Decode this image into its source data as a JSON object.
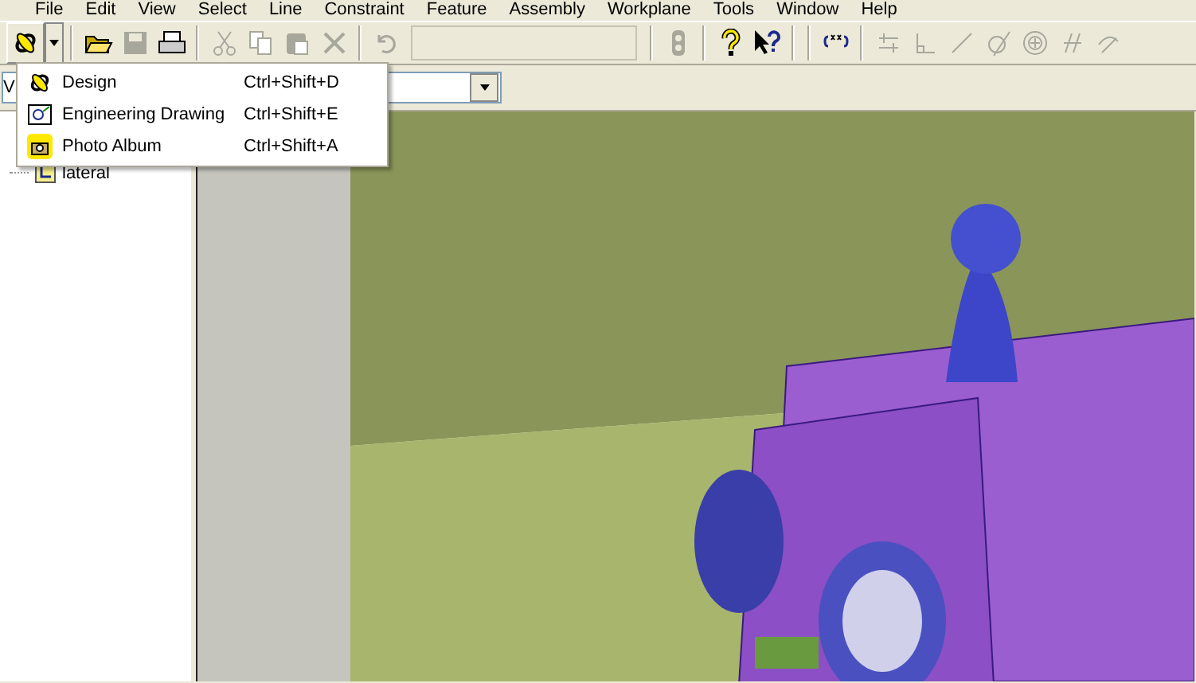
{
  "menu_bar": [
    "File",
    "Edit",
    "View",
    "Select",
    "Line",
    "Constraint",
    "Feature",
    "Assembly",
    "Workplane",
    "Tools",
    "Window",
    "Help"
  ],
  "toolbar": [
    {
      "kind": "split",
      "disabled": false
    },
    {
      "kind": "separator"
    },
    {
      "kind": "button",
      "disabled": false
    },
    {
      "kind": "button",
      "disabled": true
    },
    {
      "kind": "button",
      "disabled": false
    },
    {
      "kind": "separator"
    },
    {
      "kind": "button",
      "disabled": true
    },
    {
      "kind": "button",
      "disabled": true
    },
    {
      "kind": "button",
      "disabled": true
    },
    {
      "kind": "button",
      "disabled": true
    },
    {
      "kind": "separator"
    },
    {
      "kind": "button",
      "disabled": true
    },
    {
      "kind": "field",
      "disabled": true
    },
    {
      "kind": "separator"
    },
    {
      "kind": "button",
      "disabled": true
    },
    {
      "kind": "separator"
    },
    {
      "kind": "button",
      "disabled": false
    },
    {
      "kind": "button",
      "disabled": false
    },
    {
      "kind": "separator"
    },
    {
      "kind": "separator"
    },
    {
      "kind": "button",
      "disabled": false
    },
    {
      "kind": "separator"
    },
    {
      "kind": "button",
      "disabled": true
    },
    {
      "kind": "button",
      "disabled": true
    },
    {
      "kind": "button",
      "disabled": true
    },
    {
      "kind": "button",
      "disabled": true
    },
    {
      "kind": "button",
      "disabled": true
    },
    {
      "kind": "button",
      "disabled": true
    },
    {
      "kind": "button",
      "disabled": true
    }
  ],
  "view_combo": {
    "value": "V"
  },
  "new_menu": [
    {
      "label": "Design",
      "shortcut": "Ctrl+Shift+D"
    },
    {
      "label": "Engineering Drawing",
      "shortcut": "Ctrl+Shift+E"
    },
    {
      "label": "Photo Album",
      "shortcut": "Ctrl+Shift+A"
    }
  ],
  "tree": [
    {
      "label": "lateral"
    }
  ]
}
